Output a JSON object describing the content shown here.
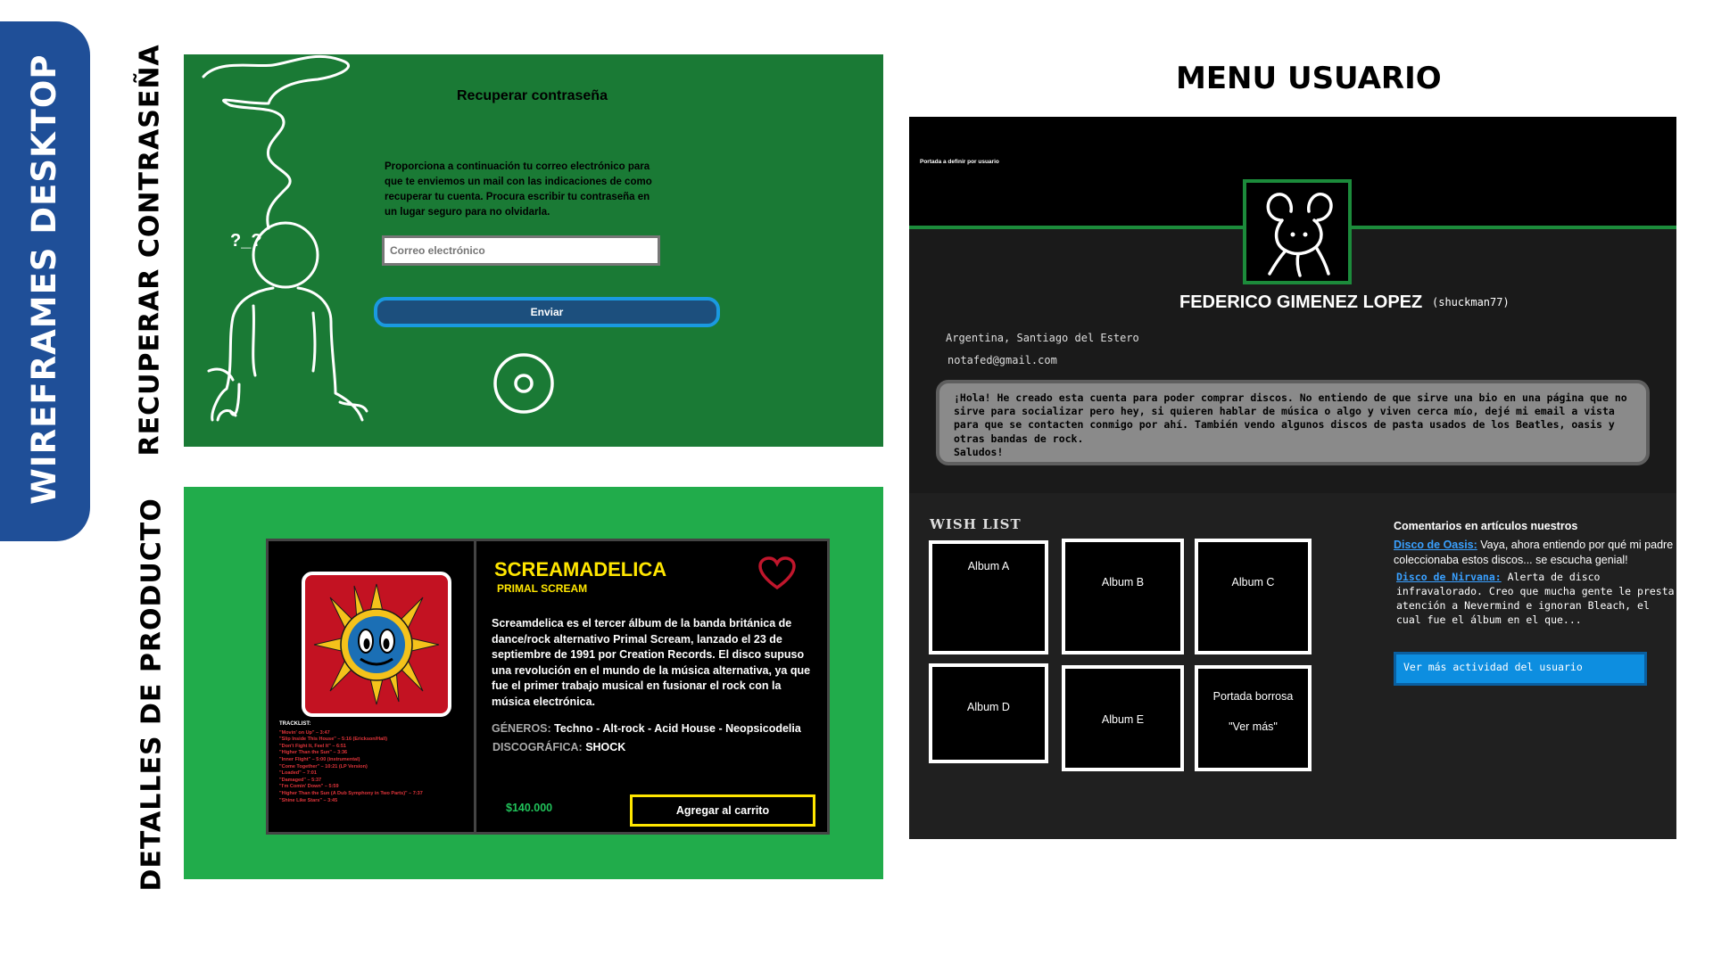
{
  "side_tab": {
    "label": "WIREFRAMES DESKTOP"
  },
  "section_labels": {
    "recover": "RECUPERAR CONTRASEÑA",
    "product": "DETALLES DE PRODUCTO"
  },
  "recover": {
    "title": "Recuperar contraseña",
    "description": "Proporciona a continuación tu correo electrónico para que te enviemos un mail con las indicaciones de como recuperar tu cuenta. Procura escribir tu contraseña en un lugar seguro para no olvidarla.",
    "email_placeholder": "Correo electrónico",
    "send_label": "Enviar",
    "doodle_face": "?_?"
  },
  "product": {
    "title": "SCREAMADELICA",
    "artist": "PRIMAL SCREAM",
    "description": "Screamdelica es el tercer álbum de la banda británica de dance/rock alternativo Primal Scream, lanzado el 23 de septiembre de 1991 por Creation Records. El disco supuso una revolución en el mundo de la música alternativa, ya que fue el primer trabajo musical en fusionar el rock con la música electrónica.",
    "genres_label": "GÉNEROS:",
    "genres": "Techno - Alt-rock - Acid House - Neopsicodelia",
    "label_label": "DISCOGRÁFICA:",
    "label": "SHOCK",
    "price": "$140.000",
    "cart_label": "Agregar al carrito",
    "tracklist_title": "TRACKLIST:",
    "tracklist": [
      "\"Movin' on Up\" – 3:47",
      "\"Slip Inside This House\" – 5:16 (Erickson/Hall)",
      "\"Don't Fight It, Feel It\" – 6:51",
      "\"Higher Than the Sun\" – 3:36",
      "\"Inner Flight\" – 5:00 (instrumental)",
      "\"Come Together\" – 10:21 (LP Version)",
      "\"Loaded\" – 7:01",
      "\"Damaged\" – 5:37",
      "\"I'm Comin' Down\" – 5:59",
      "\"Higher Than the Sun (A Dub Symphony in Two Parts)\" – 7:37",
      "\"Shine Like Stars\" – 3:45"
    ],
    "colors": {
      "accent": "#ffe600",
      "heart": "#c0162c",
      "price": "#21c25a"
    }
  },
  "user_menu": {
    "title": "MENU USUARIO",
    "cover_caption": "Portada a definir por usuario",
    "name": "FEDERICO GIMENEZ LOPEZ",
    "handle": "(shuckman77)",
    "location": "Argentina, Santiago del Estero",
    "email": "notafed@gmail.com",
    "bio": "¡Hola! He creado esta cuenta para poder comprar discos. No entiendo de que sirve una bio en una página que no sirve para socializar pero hey, si quieren hablar de música o algo y viven cerca mío, dejé mi email a vista para que se contacten conmigo por ahí. También vendo algunos discos de pasta usados de los Beatles, oasis y otras bandas de rock.\nSaludos!",
    "wishlist_title": "WISH LIST",
    "wishlist": [
      "Album A",
      "Album B",
      "Album C",
      "Album D",
      "Album E",
      "Portada borrosa",
      "\"Ver más\""
    ],
    "comments_title": "Comentarios en artículos nuestros",
    "comment_1_link": "Disco de Oasis:",
    "comment_1_text": " Vaya, ahora entiendo por qué mi padre coleccionaba estos discos... se escucha genial!",
    "comment_2_link": "Disco de Nirvana:",
    "comment_2_text": " Alerta de disco infravalorado. Creo que mucha gente le presta atención a Nevermind e ignoran Bleach, el cual fue el álbum en el que...",
    "activity_label": "Ver más actividad del usuario"
  }
}
